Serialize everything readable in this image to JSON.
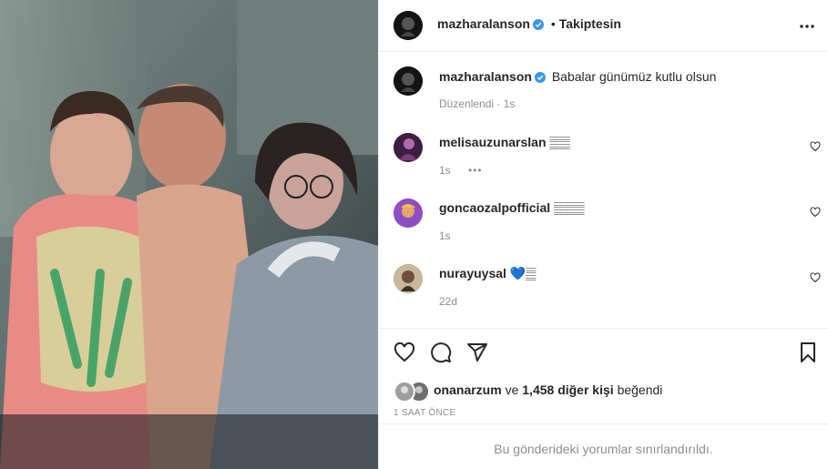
{
  "header": {
    "username": "mazharalanson",
    "dot": "•",
    "follow_status": "Takiptesin"
  },
  "caption": {
    "username": "mazharalanson",
    "text": "Babalar günümüz kutlu olsun",
    "edited": "Düzenlendi · 1s"
  },
  "comments": [
    {
      "username": "melisauzunarslan",
      "text": "𝄛𝄛",
      "time": "1s",
      "more": "•••"
    },
    {
      "username": "goncaozalpofficial",
      "text": "𝄛𝄛𝄛",
      "time": "1s"
    },
    {
      "username": "nurayuysal",
      "text": "💙𝄛",
      "time": "22d"
    }
  ],
  "likes": {
    "user": "onanarzum",
    "connector": "ve",
    "others": "1,458 diğer kişi",
    "suffix": "beğendi"
  },
  "timestamp": "1 SAAT ÖNCE",
  "restricted": "Bu gönderideki yorumlar sınırlandırıldı.",
  "colors": {
    "verified": "#3897f0",
    "muted": "#8e8e8e",
    "text": "#262626"
  }
}
